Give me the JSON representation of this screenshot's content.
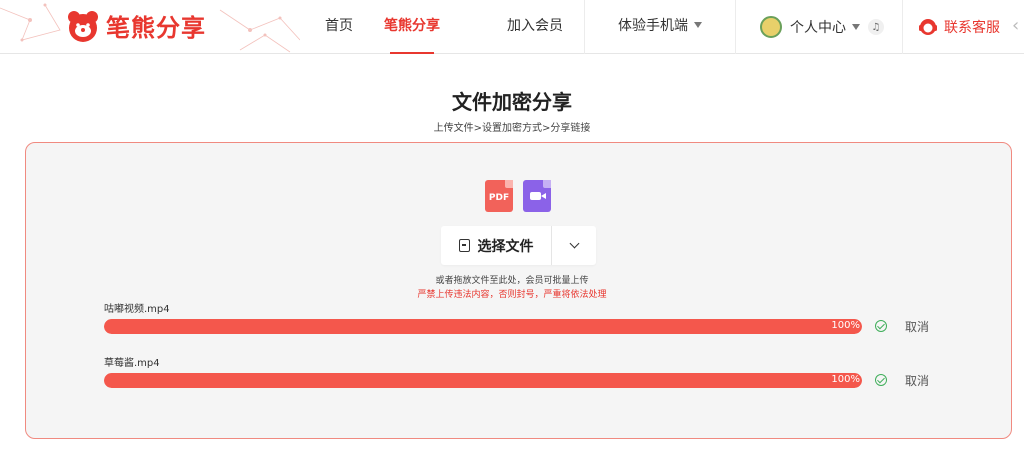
{
  "brand": {
    "name": "笔熊分享",
    "color": "#e8372f"
  },
  "nav": {
    "items": [
      {
        "label": "首页",
        "active": false
      },
      {
        "label": "笔熊分享",
        "active": true
      },
      {
        "label": "加入会员",
        "active": false
      },
      {
        "label": "体验手机端",
        "active": false,
        "dropdown": true
      }
    ]
  },
  "user": {
    "label": "个人中心",
    "icons": [
      "avatar",
      "caret-down-icon",
      "bell-icon"
    ]
  },
  "service": {
    "label": "联系客服"
  },
  "page": {
    "title": "文件加密分享",
    "breadcrumb": "上传文件>设置加密方式>分享链接"
  },
  "upload": {
    "choose_label": "选择文件",
    "file_types": [
      "pdf-icon",
      "video-icon"
    ],
    "pdf_text": "PDF",
    "hint": "或者拖放文件至此处，会员可批量上传",
    "warning": "严禁上传违法内容，否则封号，严重将依法处理"
  },
  "files": [
    {
      "name": "咕嘟视频.mp4",
      "progress": 100,
      "progress_label": "100%",
      "cancel": "取消"
    },
    {
      "name": "草莓酱.mp4",
      "progress": 100,
      "progress_label": "100%",
      "cancel": "取消"
    }
  ],
  "colors": {
    "accent": "#e8372f",
    "bar": "#f4574c",
    "ok": "#3fae5a",
    "panel_bg": "#f5f5f5"
  }
}
